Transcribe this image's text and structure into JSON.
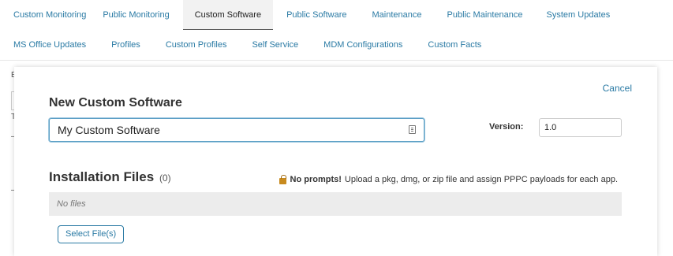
{
  "tabs_row1": [
    {
      "label": "Custom Monitoring",
      "active": false
    },
    {
      "label": "Public Monitoring",
      "active": false
    },
    {
      "label": "Custom Software",
      "active": true
    },
    {
      "label": "Public Software",
      "active": false
    },
    {
      "label": "Maintenance",
      "active": false
    },
    {
      "label": "Public Maintenance",
      "active": false
    },
    {
      "label": "System Updates",
      "active": false
    }
  ],
  "tabs_row2": [
    {
      "label": "MS Office Updates"
    },
    {
      "label": "Profiles"
    },
    {
      "label": "Custom Profiles"
    },
    {
      "label": "Self Service"
    },
    {
      "label": "MDM Configurations"
    },
    {
      "label": "Custom Facts"
    }
  ],
  "underlying": {
    "frag1": "E",
    "frag2": "T",
    "frag3": "–",
    "frag4": "–"
  },
  "modal": {
    "cancel_label": "Cancel",
    "title": "New Custom Software",
    "name_value": "My Custom Software",
    "version_label": "Version:",
    "version_value": "1.0",
    "installation_title": "Installation Files",
    "installation_count": "(0)",
    "prompt_strong": "No prompts!",
    "prompt_text": "Upload a pkg, dmg, or zip file and assign PPPC payloads for each app.",
    "empty_files_text": "No files",
    "select_files_label": "Select File(s)"
  },
  "colors": {
    "link": "#2a7aa4",
    "active_tab_bg": "#f2f2f2",
    "files_bar_bg": "#ececec"
  },
  "icons": {
    "name_field_icon": "contact-card-icon",
    "prompt_icon": "lock-icon"
  }
}
